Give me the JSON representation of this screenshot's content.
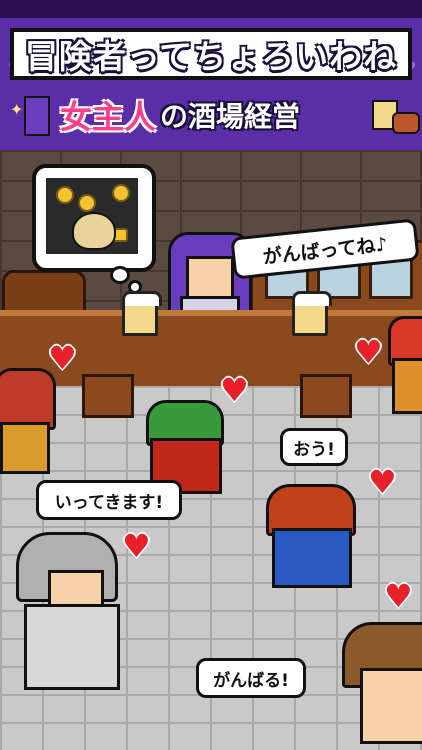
{
  "banner": {
    "title_line1": "冒険者ってちょろいわね",
    "title_line2_highlight": "女主人",
    "title_line2_rest": "の酒場経営"
  },
  "speech": {
    "keeper": "がんばってね♪",
    "adventurer_right": "おう!",
    "adventurer_left": "いってきます!",
    "adventurer_bottom": "がんばる!"
  },
  "colors": {
    "banner_bg": "#5b2ea8",
    "title_pink": "#ff3f8c",
    "heart_red": "#e8202a"
  },
  "icons": [
    "heart-icon",
    "coin-icon",
    "money-bag-icon",
    "beer-mug-icon",
    "sparkle-icon"
  ]
}
